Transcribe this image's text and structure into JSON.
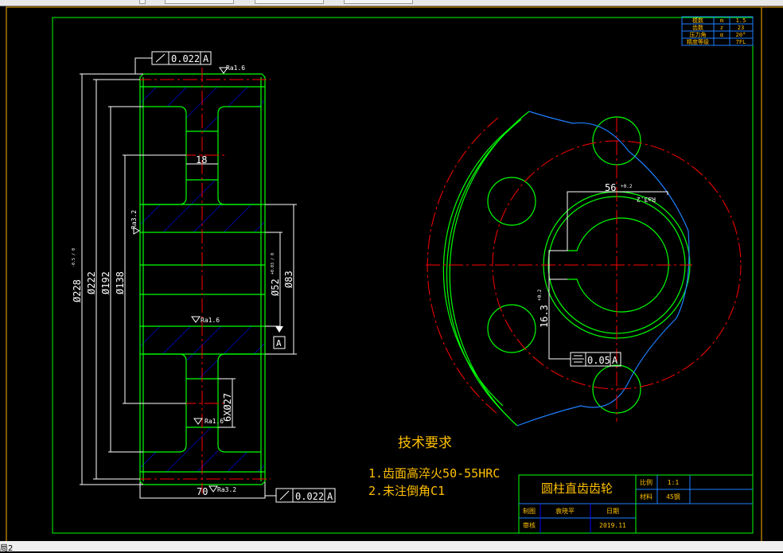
{
  "window": {
    "layout_tab": "局2"
  },
  "colors": {
    "background": "#000000",
    "outline": "#00ff00",
    "centerline": "#ff0000",
    "hatch": "#0000ff",
    "dimension": "#ffffff",
    "text": "#ffc000",
    "frame": "#ffb000",
    "table_line": "#1e7fff"
  },
  "param_table": {
    "rows": [
      {
        "name": "模数",
        "symbol": "m",
        "value": "1.5"
      },
      {
        "name": "齿数",
        "symbol": "z",
        "value": "23"
      },
      {
        "name": "压力角",
        "symbol": "α",
        "value": "20°"
      },
      {
        "name": "精度等级",
        "symbol": "",
        "value": "7FL"
      }
    ]
  },
  "section_view": {
    "dims": {
      "d_tip": "Ø228",
      "d_tip_tol": "-0.5 / 0",
      "d_pitch": "Ø222",
      "d_192": "Ø192",
      "d_138": "Ø138",
      "d_bore": "Ø52",
      "d_bore_tol": "+0.03 / 0",
      "d_hub": "Ø83",
      "web": "18",
      "holes": "6XØ27",
      "width": "70"
    },
    "roughness": {
      "top": "Ra1.6",
      "hub": "Ra1.6",
      "hole": "Ra1.6",
      "side": "Ra3.2",
      "bottom": "Ra3.2"
    },
    "runout_top": {
      "value": "0.022",
      "datum": "A"
    },
    "runout_bottom": {
      "value": "0.022",
      "datum": "A"
    },
    "datum": "A"
  },
  "front_view": {
    "keyway_width": "56",
    "keyway_width_tol": "+0.2",
    "keyway_depth": "16.3",
    "keyway_depth_tol": "+0.2",
    "roughness": "Ra3.2",
    "symmetry": {
      "value": "0.05",
      "datum": "A"
    }
  },
  "tech_req": {
    "title": "技术要求",
    "items": [
      "1.齿面高淬火50-55HRC",
      "2.未注倒角C1"
    ]
  },
  "title_block": {
    "part_name": "圆柱直齿齿轮",
    "scale_label": "比例",
    "scale_value": "1:1",
    "material_label": "材料",
    "material_value": "45钢",
    "drawn_label": "制图",
    "drawn_name": "袁晓平",
    "date_label": "日期",
    "date_value": "2019.11",
    "review_label": "审核"
  }
}
